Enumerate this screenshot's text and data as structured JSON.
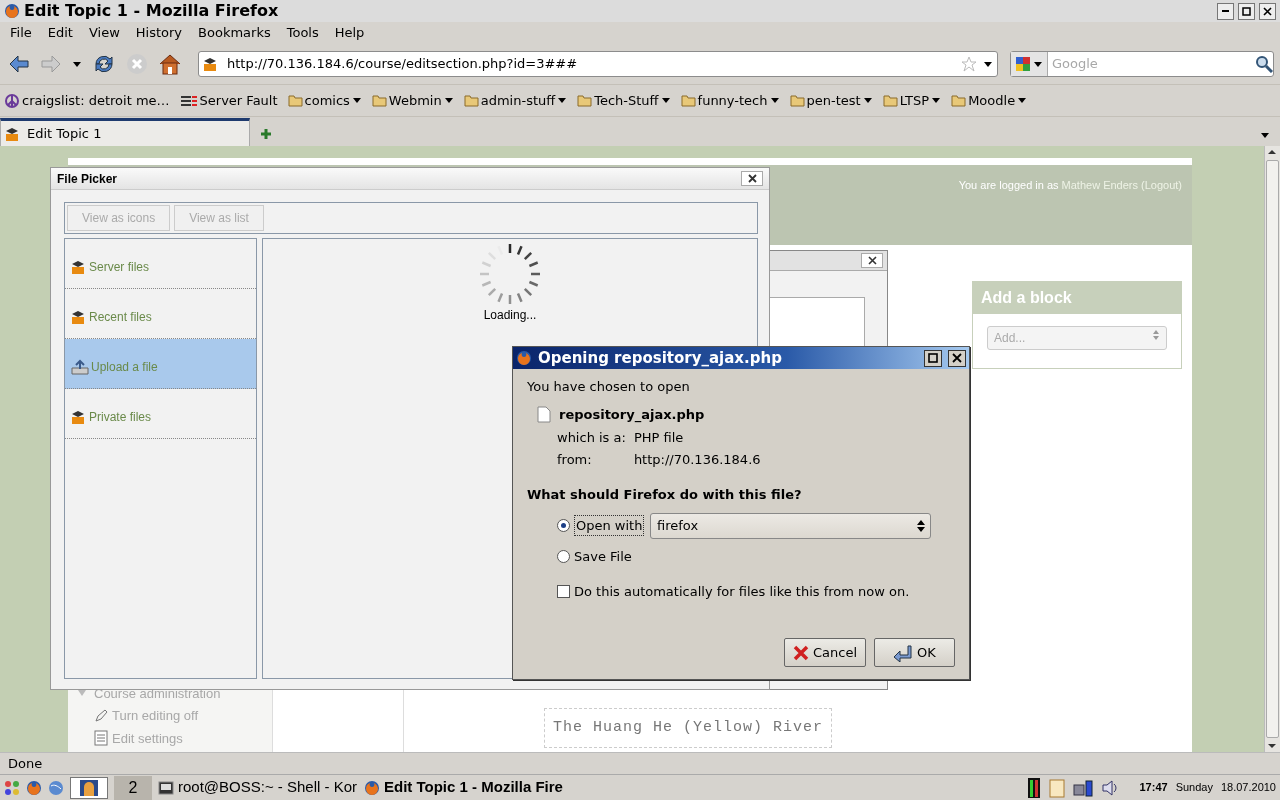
{
  "window": {
    "title": "Edit Topic 1 - Mozilla Firefox"
  },
  "menu": [
    "File",
    "Edit",
    "View",
    "History",
    "Bookmarks",
    "Tools",
    "Help"
  ],
  "address_bar": {
    "url": "http://70.136.184.6/course/editsection.php?id=3###"
  },
  "search": {
    "placeholder": "Google"
  },
  "bookmarks": [
    {
      "label": "craigslist: detroit me…",
      "kind": "peace"
    },
    {
      "label": "Server Fault",
      "kind": "bars"
    },
    {
      "label": "comics",
      "kind": "folder"
    },
    {
      "label": "Webmin",
      "kind": "folder"
    },
    {
      "label": "admin-stuff",
      "kind": "folder"
    },
    {
      "label": "Tech-Stuff",
      "kind": "folder"
    },
    {
      "label": "funny-tech",
      "kind": "folder"
    },
    {
      "label": "pen-test",
      "kind": "folder"
    },
    {
      "label": "LTSP",
      "kind": "folder"
    },
    {
      "label": "Moodle",
      "kind": "folder"
    }
  ],
  "tabs": [
    {
      "label": "Edit Topic 1",
      "selected": true
    }
  ],
  "page": {
    "login_text": "You are logged in as",
    "user": "Mathew Enders",
    "logout": "(Logout)",
    "add_block": {
      "title": "Add a block",
      "value": "Add..."
    },
    "admin": {
      "title": "Course administration",
      "items": [
        {
          "label": "Turn editing off",
          "kind": "edit"
        },
        {
          "label": "Edit settings",
          "kind": "settings"
        }
      ]
    },
    "caption": "The Huang He (Yellow) River"
  },
  "file_picker": {
    "title": "File Picker",
    "view_buttons": [
      {
        "label": "View as icons",
        "disabled": true
      },
      {
        "label": "View as list",
        "disabled": true
      }
    ],
    "repositories": [
      {
        "label": "Server files",
        "kind": "moodle",
        "selected": false
      },
      {
        "label": "Recent files",
        "kind": "moodle",
        "selected": false
      },
      {
        "label": "Upload a file",
        "kind": "upload",
        "selected": true
      },
      {
        "label": "Private files",
        "kind": "moodle",
        "selected": false
      }
    ],
    "loading": "Loading..."
  },
  "download_dialog": {
    "title": "Opening repository_ajax.php",
    "intro": "You have chosen to open",
    "file_name": "repository_ajax.php",
    "type_label": "which is a:",
    "type": "PHP file",
    "from_label": "from:",
    "from": "http://70.136.184.6",
    "question": "What should Firefox do with this file?",
    "options": [
      {
        "label": "Open with",
        "selected": true
      },
      {
        "label": "Save File",
        "selected": false
      }
    ],
    "application": "firefox",
    "auto": {
      "label": "Do this automatically for files like this from now on.",
      "checked": false
    },
    "buttons": [
      {
        "label": "Cancel",
        "kind": "cancel"
      },
      {
        "label": "OK",
        "kind": "ok"
      }
    ]
  },
  "status_bar": "Done",
  "taskbar": {
    "workspace": "2",
    "tasks": [
      {
        "label": "root@BOSS:~ - Shell - Kor",
        "kind": "terminal",
        "selected": false
      },
      {
        "label": "Edit Topic 1 - Mozilla Fire",
        "kind": "firefox",
        "selected": true
      }
    ],
    "time": "17:47",
    "day": "Sunday",
    "date": "18.07.2010"
  }
}
